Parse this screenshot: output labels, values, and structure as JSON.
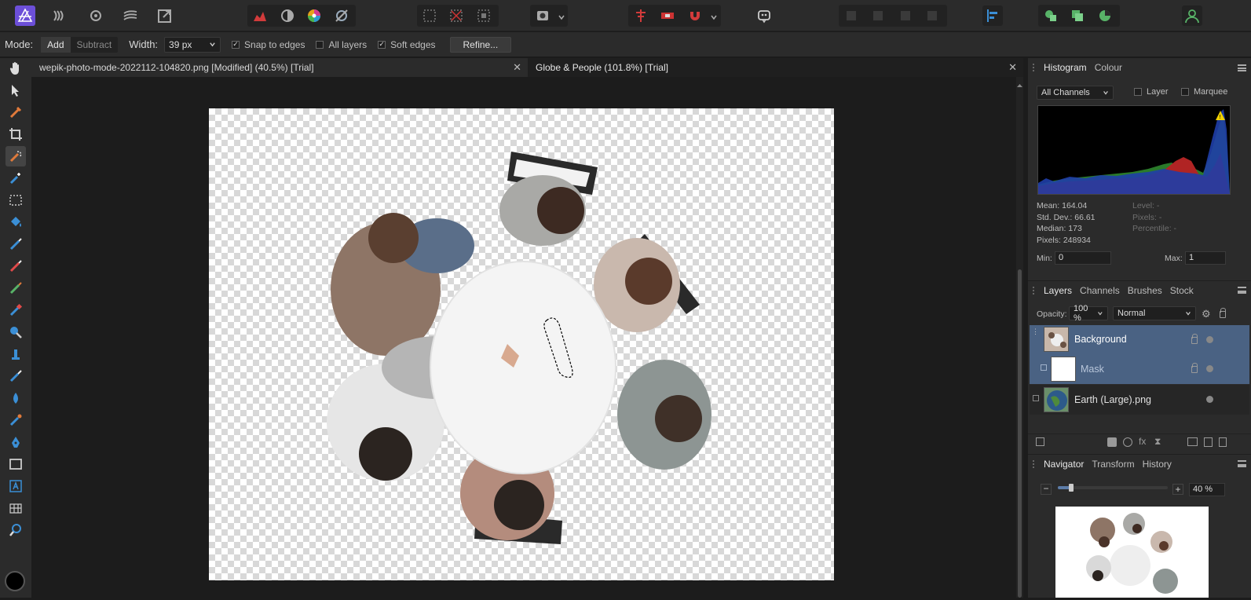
{
  "context_toolbar": {
    "mode_label": "Mode:",
    "mode_add": "Add",
    "mode_subtract": "Subtract",
    "width_label": "Width:",
    "width_value": "39 px",
    "snap_to_edges": "Snap to edges",
    "all_layers": "All layers",
    "soft_edges": "Soft edges",
    "refine_button": "Refine..."
  },
  "document_tabs": [
    {
      "label": "wepik-photo-mode-2022112-104820.png [Modified] (40.5%) [Trial]"
    },
    {
      "label": "Globe & People (101.8%) [Trial]"
    }
  ],
  "histogram_panel": {
    "tabs": [
      "Histogram",
      "Colour"
    ],
    "channel": "All Channels",
    "layer_check": "Layer",
    "marquee_check": "Marquee",
    "mean": "Mean: 164.04",
    "std_dev": "Std. Dev.: 66.61",
    "median": "Median: 173",
    "pixels": "Pixels: 248934",
    "level": "Level: -",
    "pixels_right": "Pixels: -",
    "percentile": "Percentile: -",
    "min_label": "Min:",
    "min_value": "0",
    "max_label": "Max:",
    "max_value": "1"
  },
  "layers_panel": {
    "tabs": [
      "Layers",
      "Channels",
      "Brushes",
      "Stock"
    ],
    "opacity_label": "Opacity:",
    "opacity_value": "100 %",
    "blend_mode": "Normal",
    "layers": [
      {
        "name": "Background"
      },
      {
        "name": "Mask"
      },
      {
        "name": "Earth (Large).png"
      }
    ]
  },
  "navigator_panel": {
    "tabs": [
      "Navigator",
      "Transform",
      "History"
    ],
    "zoom_value": "40 %",
    "zoom_slider_fraction": 0.12
  },
  "colors": {
    "accent_selected_layer": "#4a6283",
    "app_background": "#1c1c1c",
    "panel_background": "#2b2b2b"
  }
}
